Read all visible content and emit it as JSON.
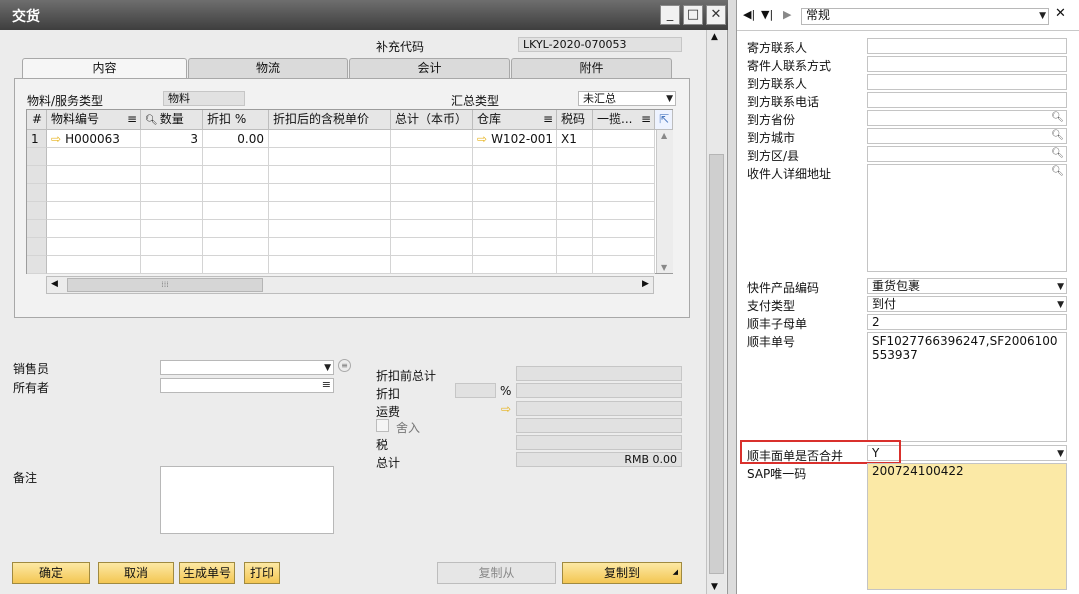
{
  "window": {
    "title": "交货"
  },
  "header": {
    "supplement_code_label": "补充代码",
    "supplement_code_value": "LKYL-2020-070053"
  },
  "tabs": [
    {
      "label": "内容"
    },
    {
      "label": "物流"
    },
    {
      "label": "会计"
    },
    {
      "label": "附件"
    }
  ],
  "content": {
    "item_type_label": "物料/服务类型",
    "item_type_value": "物料",
    "summary_type_label": "汇总类型",
    "summary_type_value": "未汇总"
  },
  "grid": {
    "columns": [
      "#",
      "物料编号",
      "数量",
      "折扣 %",
      "折扣后的含税单价",
      "总计（本币）",
      "仓库",
      "税码",
      "一揽..."
    ],
    "rows": [
      {
        "num": "1",
        "item_code": "H000063",
        "qty": "3",
        "discount": "0.00",
        "price": "",
        "total": "",
        "warehouse": "W102-001",
        "tax": "X1",
        "blanket": ""
      }
    ]
  },
  "footer_left": {
    "salesperson_label": "销售员",
    "owner_label": "所有者",
    "remarks_label": "备注"
  },
  "totals": {
    "before_discount_label": "折扣前总计",
    "discount_label": "折扣",
    "percent": "%",
    "freight_label": "运费",
    "rounding_label": "舍入",
    "tax_label": "税",
    "total_label": "总计",
    "total_value": "RMB 0.00"
  },
  "buttons": {
    "ok": "确定",
    "cancel": "取消",
    "gen_no": "生成单号",
    "print": "打印",
    "copy_from": "复制从",
    "copy_to": "复制到"
  },
  "right_panel": {
    "nav_select": "常规",
    "fields": [
      {
        "label": "寄方联系人",
        "value": ""
      },
      {
        "label": "寄件人联系方式",
        "value": ""
      },
      {
        "label": "到方联系人",
        "value": ""
      },
      {
        "label": "到方联系电话",
        "value": ""
      },
      {
        "label": "到方省份",
        "value": ""
      },
      {
        "label": "到方城市",
        "value": ""
      },
      {
        "label": "到方区/县",
        "value": ""
      }
    ],
    "address_label": "收件人详细地址",
    "product_code_label": "快件产品编码",
    "product_code_value": "重货包裹",
    "pay_type_label": "支付类型",
    "pay_type_value": "到付",
    "sub_count_label": "顺丰子母单",
    "sub_count_value": "2",
    "sf_no_label": "顺丰单号",
    "sf_no_value": "SF1027766396247,SF2006100553937",
    "merge_label": "顺丰面单是否合并",
    "merge_value": "Y",
    "sap_label": "SAP唯一码",
    "sap_value": "200724100422"
  },
  "colors": {
    "highlight_box": "#d9302c",
    "sap_field_bg": "#fbe9a6",
    "button_gold": "#f3c653"
  }
}
